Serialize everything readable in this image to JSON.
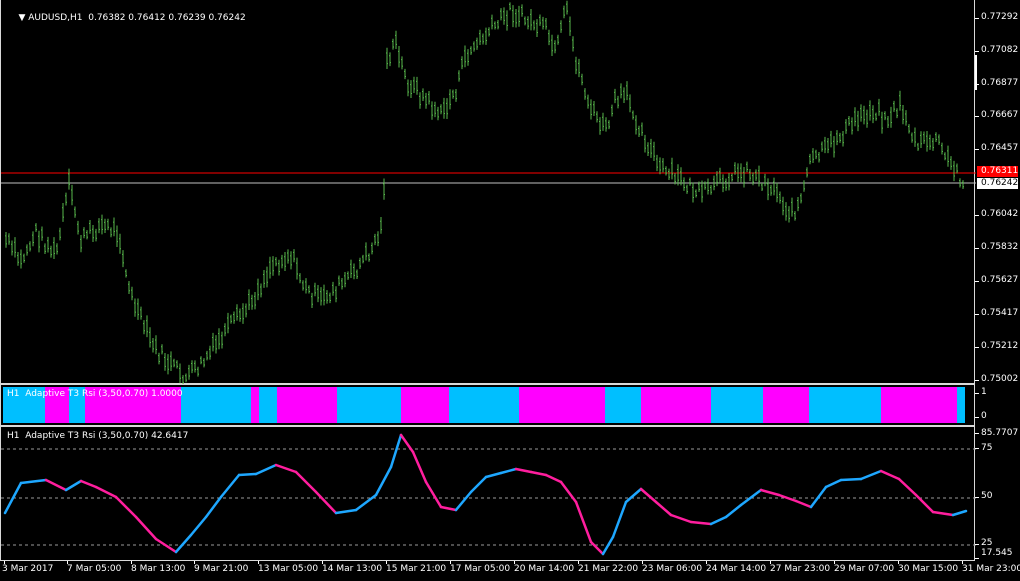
{
  "main": {
    "title": "AUDUSD,H1  0.76382 0.76412 0.76239 0.76242",
    "price_labels": [
      "0.77292",
      "0.77082",
      "0.76877",
      "0.76667",
      "0.76457",
      "0.76042",
      "0.75832",
      "0.75627",
      "0.75417",
      "0.75212",
      "0.75002"
    ],
    "bid_line_price": "0.76311",
    "last_price": "0.76242",
    "colors": {
      "bars": "#58b84d",
      "bid_line": "#ff0000",
      "last_line": "#c0c0c0"
    }
  },
  "indicator1": {
    "title": "H1  Adaptive T3 Rsi (3,50,0.70) 1.0000",
    "axis_labels": [
      "1",
      "0"
    ],
    "colors": {
      "up": "#00bfff",
      "down": "#ff00ff"
    }
  },
  "indicator2": {
    "title": "H1  Adaptive T3 Rsi (3,50,0.70) 42.6417",
    "axis_labels": [
      "85.7707",
      "75",
      "50",
      "25",
      "17.545"
    ],
    "colors": {
      "up": "#1ea7ff",
      "down": "#ff1e9e"
    }
  },
  "time_axis": [
    "3 Mar 2017",
    "7 Mar 05:00",
    "8 Mar 13:00",
    "9 Mar 21:00",
    "13 Mar 05:00",
    "14 Mar 13:00",
    "15 Mar 21:00",
    "17 Mar 05:00",
    "20 Mar 14:00",
    "21 Mar 22:00",
    "23 Mar 06:00",
    "24 Mar 14:00",
    "27 Mar 23:00",
    "29 Mar 07:00",
    "30 Mar 15:00",
    "31 Mar 23:00"
  ]
}
